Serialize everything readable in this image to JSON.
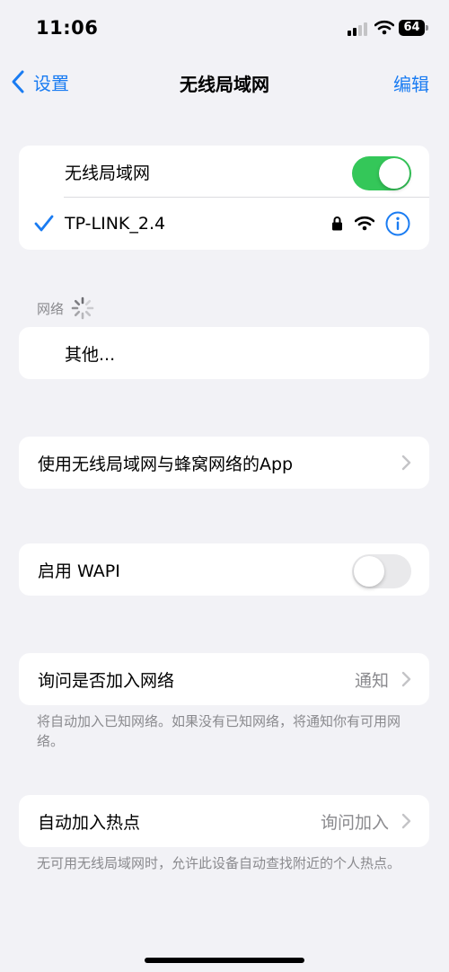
{
  "status_bar": {
    "time": "11:06",
    "battery": "64"
  },
  "nav": {
    "back_label": "设置",
    "title": "无线局域网",
    "edit_label": "编辑"
  },
  "wifi_group": {
    "toggle_label": "无线局域网",
    "toggle_on": true,
    "connected_network": "TP-LINK_2.4"
  },
  "networks_section": {
    "header": "网络",
    "other_label": "其他..."
  },
  "apps_row": {
    "label": "使用无线局域网与蜂窝网络的App"
  },
  "wapi_row": {
    "label": "启用 WAPI",
    "toggle_on": false
  },
  "ask_join": {
    "label": "询问是否加入网络",
    "value": "通知",
    "footer": "将自动加入已知网络。如果没有已知网络，将通知你有可用网络。"
  },
  "auto_hotspot": {
    "label": "自动加入热点",
    "value": "询问加入",
    "footer": "无可用无线局域网时，允许此设备自动查找附近的个人热点。"
  },
  "colors": {
    "accent": "#1a7cf2",
    "toggle_on": "#34c759",
    "background": "#f2f2f6"
  }
}
